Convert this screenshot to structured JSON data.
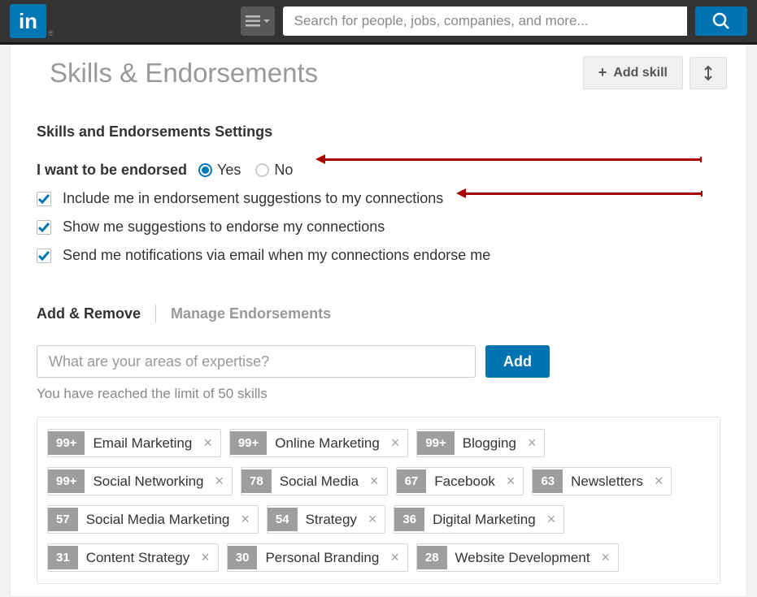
{
  "header": {
    "search_placeholder": "Search for people, jobs, companies, and more..."
  },
  "page": {
    "title": "Skills & Endorsements",
    "add_skill_label": "Add skill"
  },
  "settings": {
    "title": "Skills and Endorsements Settings",
    "endorse_label": "I want to be endorsed",
    "yes": "Yes",
    "no": "No",
    "include_label": "Include me in endorsement suggestions to my connections",
    "show_label": "Show me suggestions to endorse my connections",
    "notify_label": "Send me notifications via email when my connections endorse me"
  },
  "tabs": {
    "add_remove": "Add & Remove",
    "manage": "Manage Endorsements"
  },
  "add_area": {
    "placeholder": "What are your areas of expertise?",
    "add_label": "Add",
    "limit_note": "You have reached the limit of 50 skills"
  },
  "skills": [
    [
      {
        "count": "99+",
        "name": "Email Marketing"
      },
      {
        "count": "99+",
        "name": "Online Marketing"
      },
      {
        "count": "99+",
        "name": "Blogging"
      }
    ],
    [
      {
        "count": "99+",
        "name": "Social Networking"
      },
      {
        "count": "78",
        "name": "Social Media"
      },
      {
        "count": "67",
        "name": "Facebook"
      },
      {
        "count": "63",
        "name": "Newsletters"
      }
    ],
    [
      {
        "count": "57",
        "name": "Social Media Marketing"
      },
      {
        "count": "54",
        "name": "Strategy"
      },
      {
        "count": "36",
        "name": "Digital Marketing"
      }
    ],
    [
      {
        "count": "31",
        "name": "Content Strategy"
      },
      {
        "count": "30",
        "name": "Personal Branding"
      },
      {
        "count": "28",
        "name": "Website Development"
      }
    ]
  ]
}
